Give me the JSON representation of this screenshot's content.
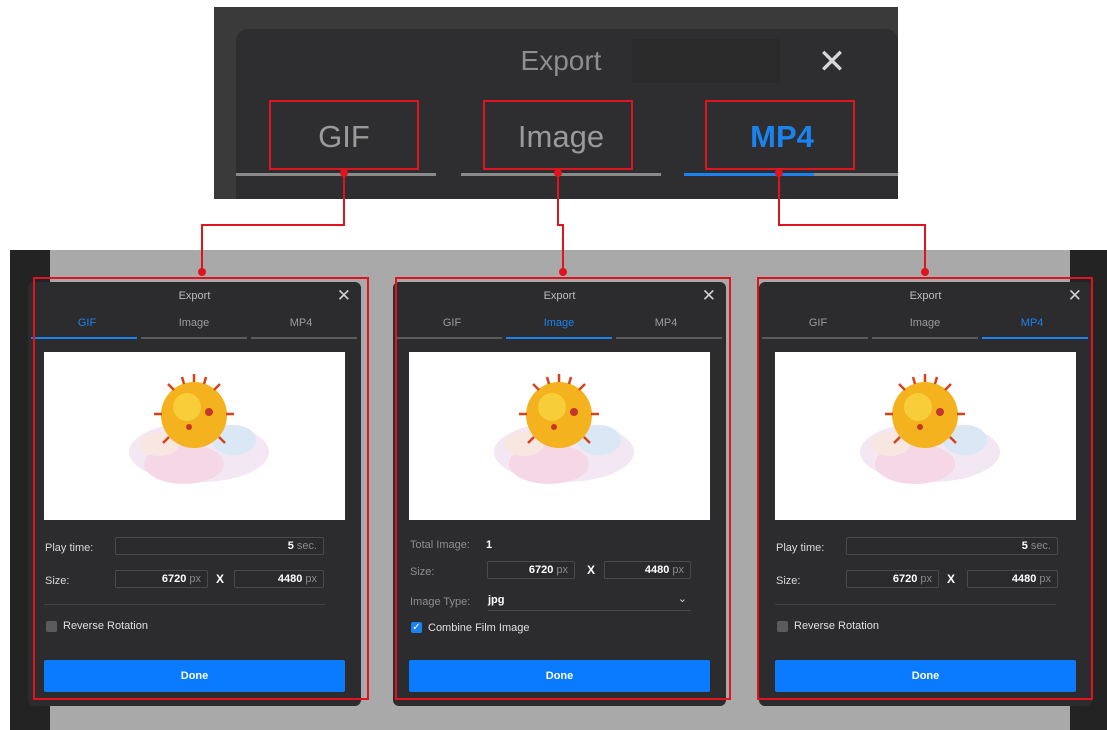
{
  "header_zoom": {
    "title": "Export",
    "close": "✕",
    "tabs": [
      {
        "label": "GIF",
        "active": false
      },
      {
        "label": "Image",
        "active": false
      },
      {
        "label": "MP4",
        "active": true
      }
    ]
  },
  "colors": {
    "accent": "#1a83f0",
    "highlight": "#e0141e",
    "dialog_bg": "#2c2c2e",
    "done": "#0a7bff"
  },
  "icons": [
    "close-icon",
    "checkbox-icon",
    "chevron-down-icon"
  ],
  "dialogs": [
    {
      "active_tab": "GIF",
      "title": "Export",
      "tabs": [
        "GIF",
        "Image",
        "MP4"
      ],
      "play_time_label": "Play time:",
      "play_time_value": "5",
      "play_time_unit": "sec.",
      "size_label": "Size:",
      "width": "6720",
      "height": "4480",
      "px": "px",
      "times": "X",
      "reverse_label": "Reverse Rotation",
      "done": "Done"
    },
    {
      "active_tab": "Image",
      "title": "Export",
      "tabs": [
        "GIF",
        "Image",
        "MP4"
      ],
      "total_label": "Total Image:",
      "total_value": "1",
      "size_label": "Size:",
      "width": "6720",
      "height": "4480",
      "px": "px",
      "times": "X",
      "type_label": "Image Type:",
      "type_value": "jpg",
      "combine_label": "Combine Film Image",
      "done": "Done"
    },
    {
      "active_tab": "MP4",
      "title": "Export",
      "tabs": [
        "GIF",
        "Image",
        "MP4"
      ],
      "play_time_label": "Play time:",
      "play_time_value": "5",
      "play_time_unit": "sec.",
      "size_label": "Size:",
      "width": "6720",
      "height": "4480",
      "px": "px",
      "times": "X",
      "reverse_label": "Reverse Rotation",
      "done": "Done"
    }
  ]
}
